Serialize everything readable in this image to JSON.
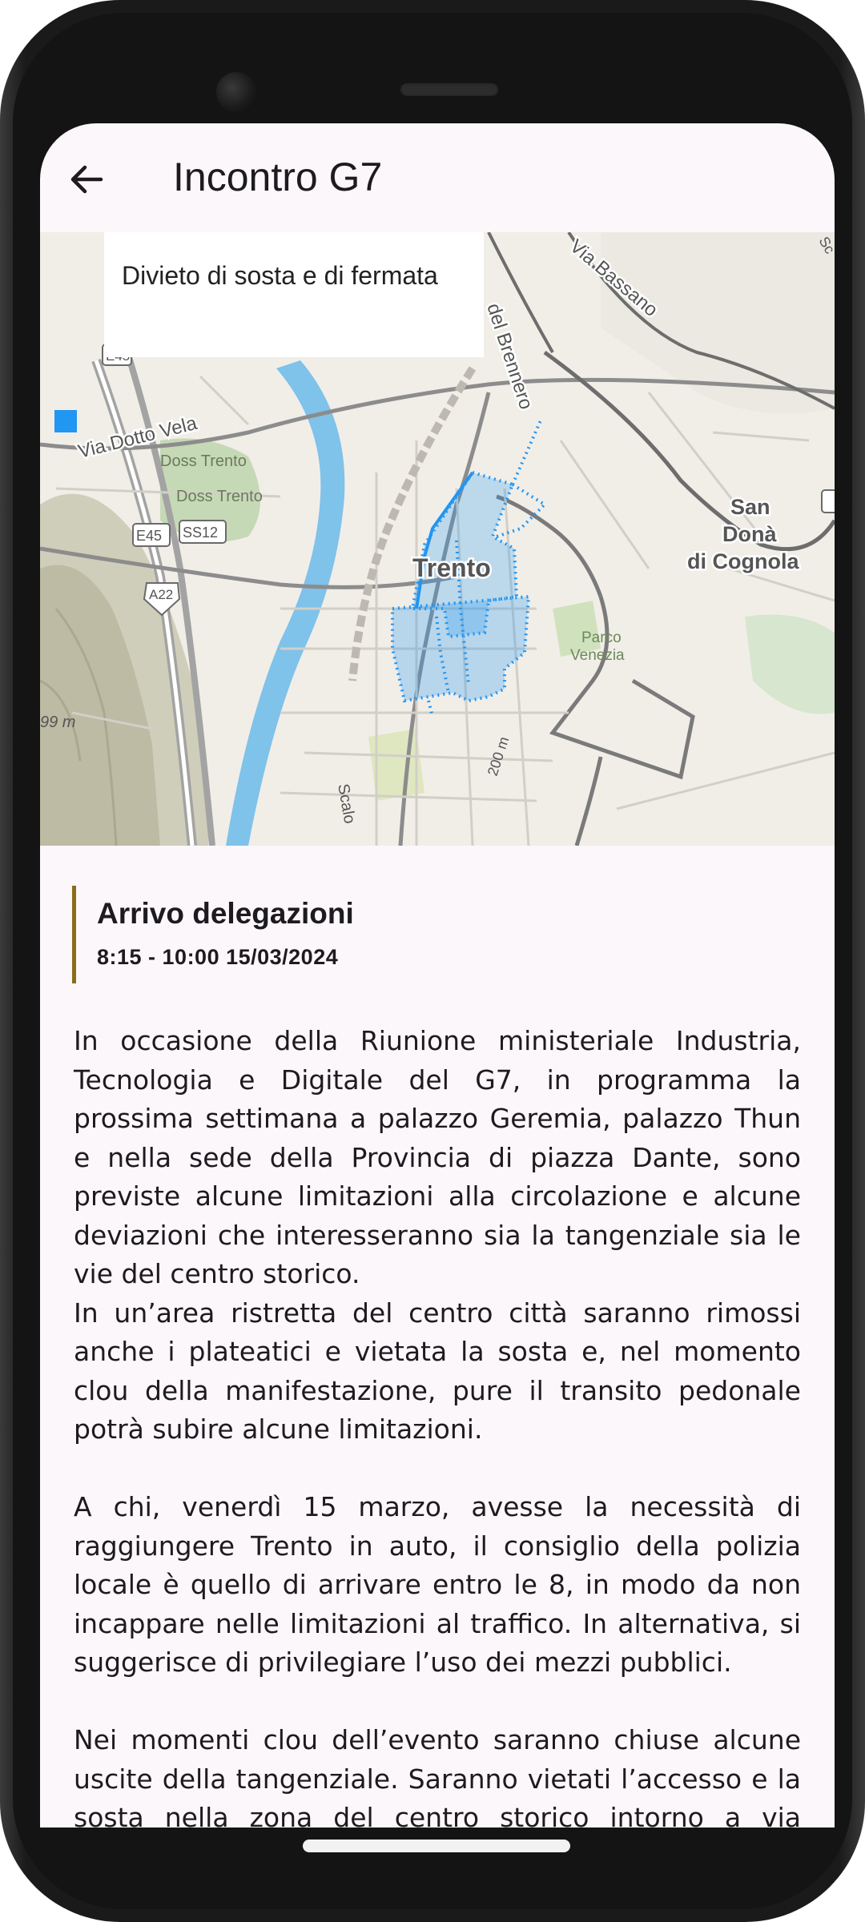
{
  "appbar": {
    "title": "Incontro G7"
  },
  "map": {
    "legend_label": "Divieto di sosta e di fermata",
    "legend_color": "#2196f3",
    "zone_color": "#2196f3",
    "labels": {
      "via_dotto_vela": "Via Dotto Vela",
      "doss_trento_1": "Doss Trento",
      "doss_trento_2": "Doss Trento",
      "e45_top": "E45",
      "e45": "E45",
      "ss12": "SS12",
      "a22": "A22",
      "elev_99": "99 m",
      "elev_200": "200 m",
      "brennero": "del Brennero",
      "bassano": "Via Bassano",
      "trento": "Trento",
      "san_dona_1": "San",
      "san_dona_2": "Donà",
      "san_dona_3": "di Cognola",
      "parco_1": "Parco",
      "parco_2": "Venezia",
      "scalo": "Scalo",
      "sc": "Sc"
    }
  },
  "event": {
    "title": "Arrivo delegazioni",
    "time": "8:15 - 10:00 15/03/2024",
    "accent_color": "#8a6d1a"
  },
  "body": {
    "p1": "In occasione della Riunione ministeriale Industria, Tecnologia e Digitale del G7, in programma la prossima settimana a palazzo Geremia, palazzo Thun e nella sede della Provincia di piazza Dante, sono previste alcune limitazioni alla circolazione e alcune deviazioni che interesseranno sia la tangenziale sia le vie del centro storico.",
    "p2": "In un’area ristretta del centro città saranno rimossi anche i plateatici e vietata la sosta e, nel momento clou della manifestazione, pure il transito pedonale potrà subire alcune limitazioni.",
    "p3": "A chi, venerdì 15 marzo, avesse la necessità di raggiungere Trento in auto, il consiglio della polizia locale è quello di arrivare entro le 8, in modo da non incappare nelle limitazioni al traffico. In alternativa, si suggerisce di privilegiare l’uso dei mezzi pubblici.",
    "p4": "Nei momenti clou dell’evento saranno chiuse alcune uscite della tangenziale. Saranno vietati l’accesso e la sosta nella zona del centro storico intorno a via Belenzani (da piazza"
  }
}
